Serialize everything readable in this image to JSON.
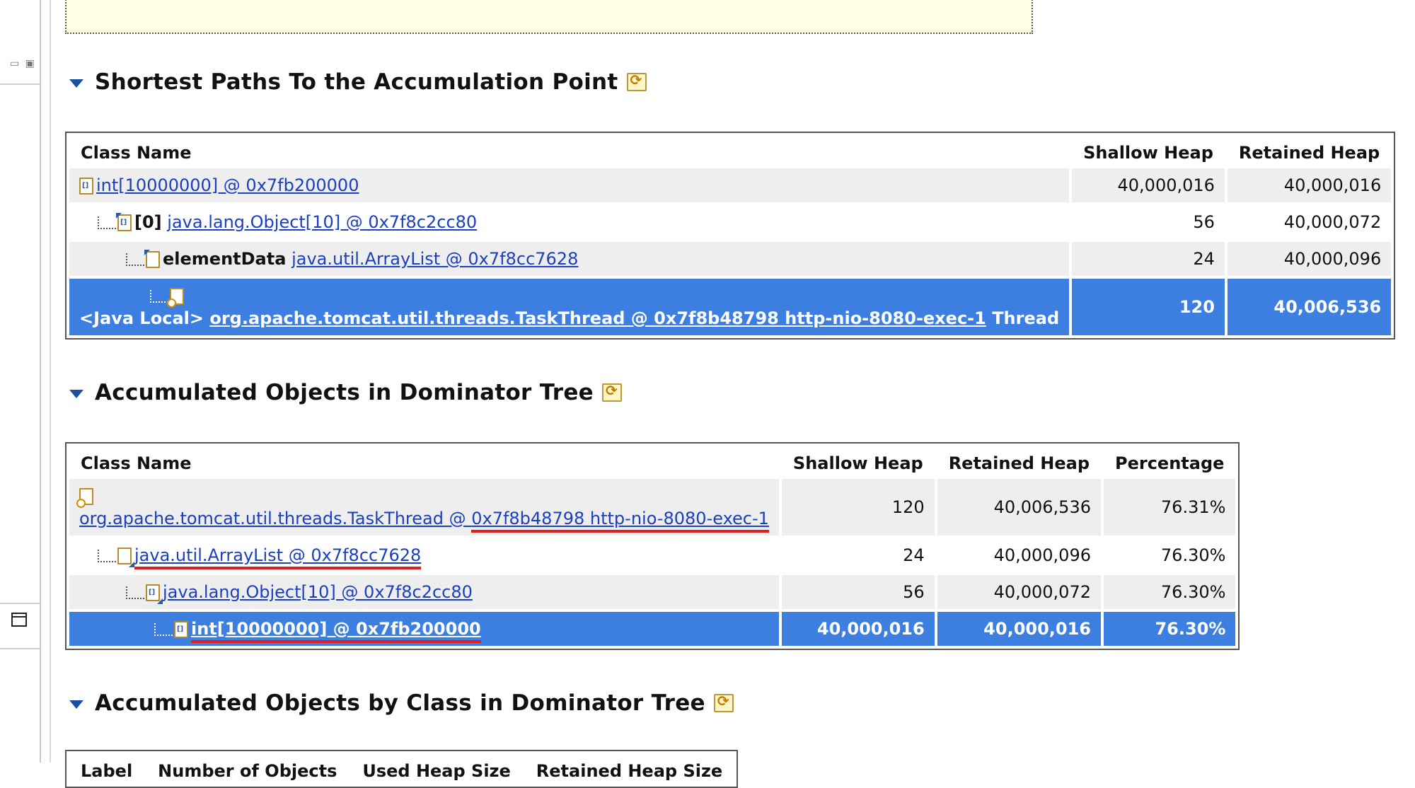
{
  "sections": {
    "paths": {
      "title": "Shortest Paths To the Accumulation Point"
    },
    "dominator": {
      "title": "Accumulated Objects in Dominator Tree"
    },
    "byclass": {
      "title": "Accumulated Objects by Class in Dominator Tree"
    }
  },
  "paths_table": {
    "headers": {
      "class_name": "Class Name",
      "shallow": "Shallow Heap",
      "retained": "Retained Heap"
    },
    "rows": [
      {
        "field": "",
        "link": "int[10000000] @ 0x7fb200000",
        "suffix": "",
        "shallow": "40,000,016",
        "retained": "40,000,016"
      },
      {
        "field": "[0]",
        "link": "java.lang.Object[10] @ 0x7f8c2cc80",
        "suffix": "",
        "shallow": "56",
        "retained": "40,000,072"
      },
      {
        "field": "elementData",
        "link": "java.util.ArrayList @ 0x7f8cc7628",
        "suffix": "",
        "shallow": "24",
        "retained": "40,000,096"
      },
      {
        "field": "<Java Local>",
        "link": "org.apache.tomcat.util.threads.TaskThread @ 0x7f8b48798 http-nio-8080-exec-1",
        "suffix": "Thread",
        "shallow": "120",
        "retained": "40,006,536"
      }
    ]
  },
  "dominator_table": {
    "headers": {
      "class_name": "Class Name",
      "shallow": "Shallow Heap",
      "retained": "Retained Heap",
      "percentage": "Percentage"
    },
    "rows": [
      {
        "link_a": "org.apache.tomcat.util.threads.TaskThread @ ",
        "link_b": "0x7f8b48798 http-nio-8080-exec-1",
        "shallow": "120",
        "retained": "40,006,536",
        "pct": "76.31%"
      },
      {
        "link": "java.util.ArrayList @ 0x7f8cc7628",
        "shallow": "24",
        "retained": "40,000,096",
        "pct": "76.30%"
      },
      {
        "link": "java.lang.Object[10] @ 0x7f8c2cc80",
        "shallow": "56",
        "retained": "40,000,072",
        "pct": "76.30%"
      },
      {
        "link": "int[10000000] @ 0x7fb200000",
        "shallow": "40,000,016",
        "retained": "40,000,016",
        "pct": "76.30%"
      }
    ]
  },
  "byclass_table": {
    "headers": {
      "label": "Label",
      "count": "Number of Objects",
      "used": "Used Heap Size",
      "retained": "Retained Heap Size"
    }
  }
}
